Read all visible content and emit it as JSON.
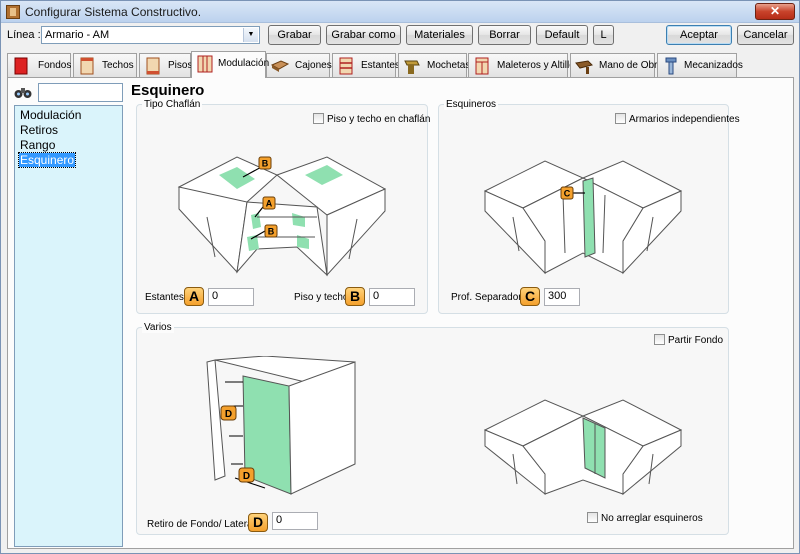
{
  "window": {
    "title": "Configurar Sistema Constructivo.",
    "close_label": "✕"
  },
  "toolbar": {
    "linea_label": "Línea :",
    "linea_value": "Armario - AM",
    "buttons": [
      "Grabar",
      "Grabar como",
      "Materiales",
      "Borrar",
      "Default",
      "L"
    ],
    "accept_label": "Aceptar",
    "cancel_label": "Cancelar"
  },
  "tabs": [
    {
      "label": "Fondos",
      "icon": "fondos-icon"
    },
    {
      "label": "Techos",
      "icon": "techos-icon"
    },
    {
      "label": "Pisos",
      "icon": "pisos-icon"
    },
    {
      "label": "Modulación",
      "icon": "modulacion-icon",
      "active": true
    },
    {
      "label": "Cajones",
      "icon": "cajones-icon"
    },
    {
      "label": "Estantes",
      "icon": "estantes-icon"
    },
    {
      "label": "Mochetas",
      "icon": "mochetas-icon"
    },
    {
      "label": "Maleteros y Altillos",
      "icon": "maleteros-icon"
    },
    {
      "label": "Mano de Obra",
      "icon": "mano-de-obra-icon"
    },
    {
      "label": "Mecanizados",
      "icon": "mecanizados-icon"
    }
  ],
  "sidebar": {
    "search_value": "",
    "items": [
      "Modulación",
      "Retiros",
      "Rango",
      "Esquinero"
    ],
    "selected": "Esquinero"
  },
  "main": {
    "heading": "Esquinero",
    "chaflan": {
      "title": "Tipo Chaflán",
      "checkbox_label": "Piso y techo en chaflán",
      "estantes_label": "Estantes",
      "estantes_value": "0",
      "piso_techo_label": "Piso y techo",
      "piso_techo_value": "0",
      "badge_a": "A",
      "badge_b": "B"
    },
    "esquineros": {
      "title": "Esquineros",
      "checkbox_label": "Armarios independientes",
      "separador_label": "Prof. Separador",
      "separador_value": "300",
      "badge_c": "C"
    },
    "varios": {
      "title": "Varios",
      "partir_label": "Partir Fondo",
      "retiro_label": "Retiro de Fondo/ Lateral",
      "retiro_value": "0",
      "no_arreglar_label": "No arreglar esquineros",
      "badge_d": "D"
    }
  },
  "colors": {
    "accent_green": "#8fe0b0",
    "badge_orange": "#f4a02c",
    "list_bg": "#daf4fb"
  }
}
